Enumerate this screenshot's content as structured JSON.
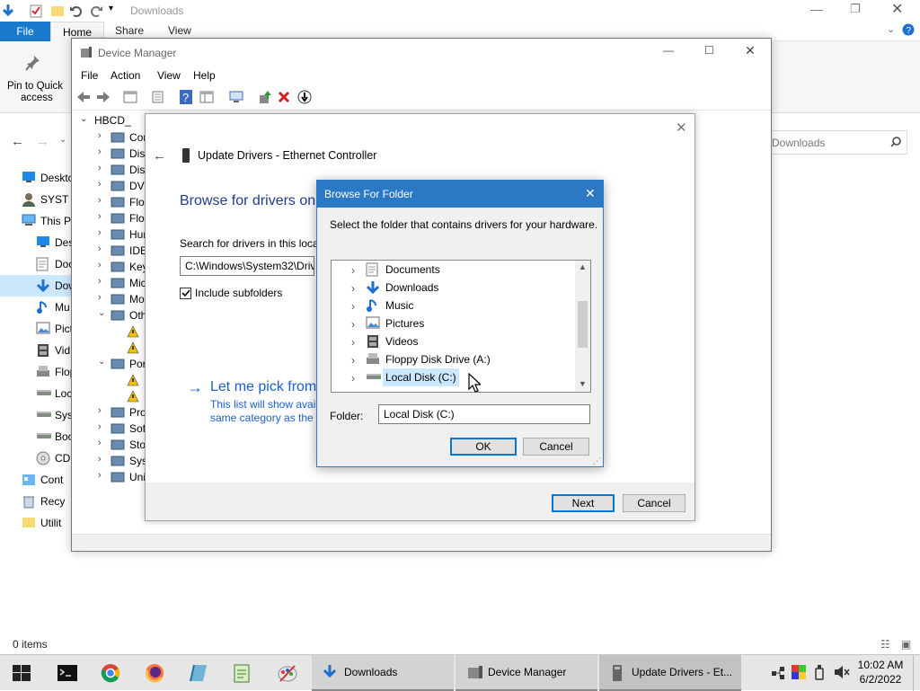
{
  "explorer": {
    "title": "Downloads",
    "tabs": {
      "file": "File",
      "home": "Home",
      "share": "Share",
      "view": "View"
    },
    "ribbon": {
      "pin_label_1": "Pin to Quick",
      "pin_label_2": "access"
    },
    "search_placeholder": "Downloads",
    "tree": [
      {
        "label": "Deskto",
        "icon": "desktop-icon"
      },
      {
        "label": "SYST",
        "icon": "user-icon"
      },
      {
        "label": "This P",
        "icon": "computer-icon"
      },
      {
        "label": "Des",
        "icon": "desktop-icon"
      },
      {
        "label": "Doc",
        "icon": "documents-icon"
      },
      {
        "label": "Dow",
        "icon": "downloads-icon",
        "selected": true
      },
      {
        "label": "Mu",
        "icon": "music-icon"
      },
      {
        "label": "Pict",
        "icon": "pictures-icon"
      },
      {
        "label": "Vid",
        "icon": "videos-icon"
      },
      {
        "label": "Flop",
        "icon": "floppy-icon"
      },
      {
        "label": "Loc",
        "icon": "drive-icon"
      },
      {
        "label": "Sys",
        "icon": "drive-icon"
      },
      {
        "label": "Boo",
        "icon": "drive-icon"
      },
      {
        "label": "CD",
        "icon": "cd-icon"
      },
      {
        "label": "Cont",
        "icon": "control-panel-icon"
      },
      {
        "label": "Recy",
        "icon": "recycle-icon"
      },
      {
        "label": "Utilit",
        "icon": "folder-icon"
      }
    ],
    "status": "0 items"
  },
  "device_manager": {
    "title": "Device Manager",
    "menu": {
      "file": "File",
      "action": "Action",
      "view": "View",
      "help": "Help"
    },
    "root": "HBCD_",
    "tree": [
      {
        "label": "Cor",
        "expand": ">"
      },
      {
        "label": "Disk",
        "expand": ">"
      },
      {
        "label": "Disp",
        "expand": ">"
      },
      {
        "label": "DVD",
        "expand": ">"
      },
      {
        "label": "Flop",
        "expand": ">"
      },
      {
        "label": "Flop",
        "expand": ">"
      },
      {
        "label": "Hur",
        "expand": ">"
      },
      {
        "label": "IDE",
        "expand": ">"
      },
      {
        "label": "Key",
        "expand": ">"
      },
      {
        "label": "Mic",
        "expand": ">"
      },
      {
        "label": "Mo",
        "expand": ">"
      },
      {
        "label": "Oth",
        "expand": "v"
      },
      {
        "label": "",
        "expand": "",
        "child": true
      },
      {
        "label": "",
        "expand": "",
        "child": true
      },
      {
        "label": "Por",
        "expand": "v"
      },
      {
        "label": "",
        "expand": "",
        "child": true
      },
      {
        "label": "",
        "expand": "",
        "child": true
      },
      {
        "label": "Pro",
        "expand": ">"
      },
      {
        "label": "Soft",
        "expand": ">"
      },
      {
        "label": "Stor",
        "expand": ">"
      },
      {
        "label": "Syst",
        "expand": ">"
      },
      {
        "label": "Uni",
        "expand": ">"
      }
    ]
  },
  "update_drivers": {
    "title": "Update Drivers - Ethernet Controller",
    "heading": "Browse for drivers on",
    "search_label": "Search for drivers in this locat",
    "path_value": "C:\\Windows\\System32\\Driv",
    "include_subfolders": "Include subfolders",
    "link": "Let me pick from",
    "link_desc_1": "This list will show avail",
    "link_desc_2": "same category as the d",
    "next": "Next",
    "cancel": "Cancel"
  },
  "browse_folder": {
    "title": "Browse For Folder",
    "instruction": "Select the folder that contains drivers for your hardware.",
    "items": [
      {
        "label": "Documents",
        "icon": "documents-icon"
      },
      {
        "label": "Downloads",
        "icon": "downloads-icon"
      },
      {
        "label": "Music",
        "icon": "music-icon"
      },
      {
        "label": "Pictures",
        "icon": "pictures-icon"
      },
      {
        "label": "Videos",
        "icon": "videos-icon"
      },
      {
        "label": "Floppy Disk Drive (A:)",
        "icon": "floppy-icon"
      },
      {
        "label": "Local Disk (C:)",
        "icon": "drive-icon",
        "selected": true
      }
    ],
    "folder_label": "Folder:",
    "folder_value": "Local Disk (C:)",
    "ok": "OK",
    "cancel": "Cancel"
  },
  "taskbar": {
    "apps": [
      {
        "label": "Downloads",
        "icon": "downloads-icon"
      },
      {
        "label": "Device Manager",
        "icon": "device-manager-icon"
      },
      {
        "label": "Update Drivers - Et...",
        "icon": "update-drivers-icon",
        "active": true
      }
    ],
    "time": "10:02 AM",
    "date": "6/2/2022"
  },
  "colors": {
    "accent": "#0078d7",
    "title_blue": "#2b78c4",
    "link_blue": "#1c5fcc",
    "selection": "#cce8ff"
  }
}
